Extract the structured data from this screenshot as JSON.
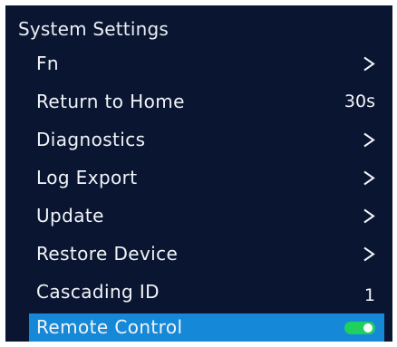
{
  "screen": {
    "title": "System Settings"
  },
  "menu": {
    "items": [
      {
        "label": "Fn",
        "value": null,
        "icon": "chevron-right-icon"
      },
      {
        "label": "Return to Home",
        "value": "30s",
        "icon": null
      },
      {
        "label": "Diagnostics",
        "value": null,
        "icon": "chevron-right-icon"
      },
      {
        "label": "Log Export",
        "value": null,
        "icon": "chevron-right-icon"
      },
      {
        "label": "Update",
        "value": null,
        "icon": "chevron-right-icon"
      },
      {
        "label": "Restore Device",
        "value": null,
        "icon": "chevron-right-icon"
      },
      {
        "label": "Cascading ID",
        "value": "1",
        "icon": null
      },
      {
        "label": "Remote Control",
        "value": null,
        "icon": "toggle-switch-icon",
        "toggle_on": true,
        "selected": true
      }
    ]
  },
  "colors": {
    "background": "#0a1631",
    "highlight": "#1688d8",
    "toggle_on": "#1fd15c",
    "text": "#f2f4f8"
  }
}
